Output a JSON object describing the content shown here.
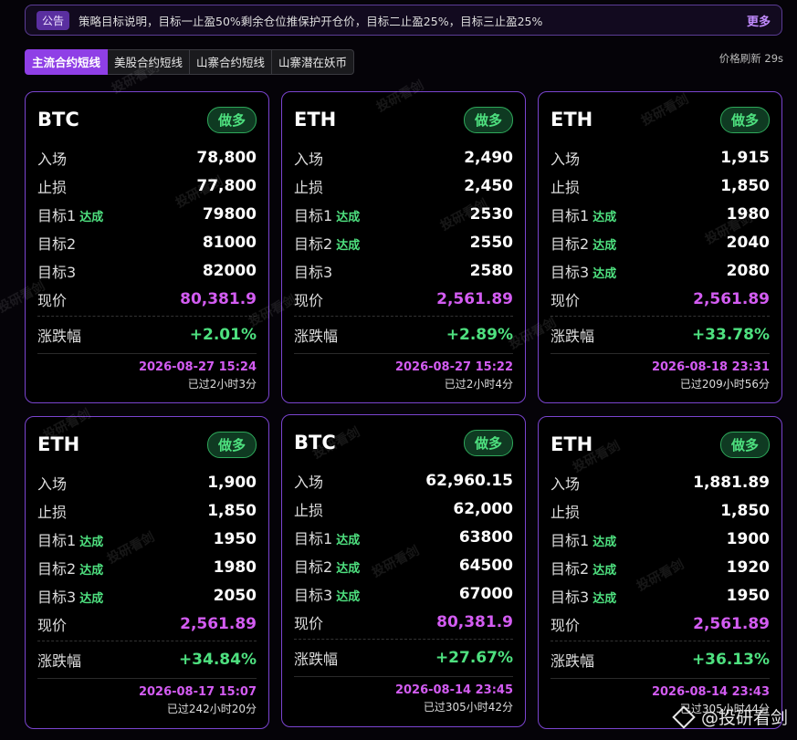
{
  "notice": {
    "badge": "公告",
    "text": "策略目标说明，目标一止盈50%剩余仓位推保护开仓价，目标二止盈25%，目标三止盈25%",
    "more": "更多"
  },
  "tabs": [
    "主流合约短线",
    "美股合约短线",
    "山寨合约短线",
    "山寨潜在妖币"
  ],
  "refresh": "价格刷新 29s",
  "labels": {
    "entry": "入场",
    "stop": "止损",
    "t1": "目标1",
    "t2": "目标2",
    "t3": "目标3",
    "price": "现价",
    "change": "涨跌幅",
    "hit": "达成"
  },
  "watermark": "投研看剑",
  "brand": "@投研看剑",
  "cards": [
    {
      "symbol": "BTC",
      "direction": "做多",
      "entry": "78,800",
      "stop": "77,800",
      "t1": "79800",
      "t1_hit": true,
      "t2": "81000",
      "t2_hit": false,
      "t3": "82000",
      "t3_hit": false,
      "price": "80,381.9",
      "change": "+2.01%",
      "date": "2026-08-27 15:24",
      "elapsed": "已过2小时3分"
    },
    {
      "symbol": "ETH",
      "direction": "做多",
      "entry": "2,490",
      "stop": "2,450",
      "t1": "2530",
      "t1_hit": true,
      "t2": "2550",
      "t2_hit": true,
      "t3": "2580",
      "t3_hit": false,
      "price": "2,561.89",
      "change": "+2.89%",
      "date": "2026-08-27 15:22",
      "elapsed": "已过2小时4分"
    },
    {
      "symbol": "ETH",
      "direction": "做多",
      "entry": "1,915",
      "stop": "1,850",
      "t1": "1980",
      "t1_hit": true,
      "t2": "2040",
      "t2_hit": true,
      "t3": "2080",
      "t3_hit": true,
      "price": "2,561.89",
      "change": "+33.78%",
      "date": "2026-08-18 23:31",
      "elapsed": "已过209小时56分"
    },
    {
      "symbol": "ETH",
      "direction": "做多",
      "entry": "1,900",
      "stop": "1,850",
      "t1": "1950",
      "t1_hit": true,
      "t2": "1980",
      "t2_hit": true,
      "t3": "2050",
      "t3_hit": true,
      "price": "2,561.89",
      "change": "+34.84%",
      "date": "2026-08-17 15:07",
      "elapsed": "已过242小时20分"
    },
    {
      "symbol": "BTC",
      "direction": "做多",
      "entry": "62,960.15",
      "stop": "62,000",
      "t1": "63800",
      "t1_hit": true,
      "t2": "64500",
      "t2_hit": true,
      "t3": "67000",
      "t3_hit": true,
      "price": "80,381.9",
      "change": "+27.67%",
      "date": "2026-08-14 23:45",
      "elapsed": "已过305小时42分"
    },
    {
      "symbol": "ETH",
      "direction": "做多",
      "entry": "1,881.89",
      "stop": "1,850",
      "t1": "1900",
      "t1_hit": true,
      "t2": "1920",
      "t2_hit": true,
      "t3": "1950",
      "t3_hit": true,
      "price": "2,561.89",
      "change": "+36.13%",
      "date": "2026-08-14 23:43",
      "elapsed": "已过305小时44分"
    }
  ]
}
